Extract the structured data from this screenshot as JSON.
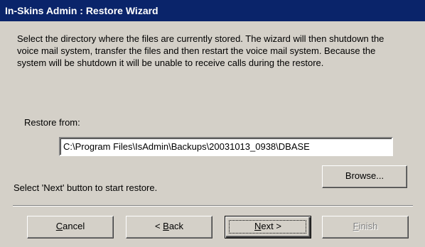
{
  "window": {
    "title": "In-Skins Admin : Restore Wizard"
  },
  "description": "Select the directory where the files are currently stored. The wizard will then shutdown the voice mail system, transfer the files and then restart the voice mail system. Because the system will be shutdown it will be unable to receive calls during the restore.",
  "restore": {
    "label": "Restore from:",
    "path": "C:\\Program Files\\IsAdmin\\Backups\\20031013_0938\\DBASE",
    "browse_label": "Browse..."
  },
  "hint": "Select 'Next' button to start restore.",
  "buttons": {
    "cancel": {
      "mnemonic": "C",
      "rest": "ancel"
    },
    "back": {
      "prefix": "< ",
      "mnemonic": "B",
      "rest": "ack"
    },
    "next": {
      "mnemonic": "N",
      "rest": "ext >"
    },
    "finish": {
      "mnemonic": "F",
      "rest": "inish",
      "enabled": false
    }
  }
}
